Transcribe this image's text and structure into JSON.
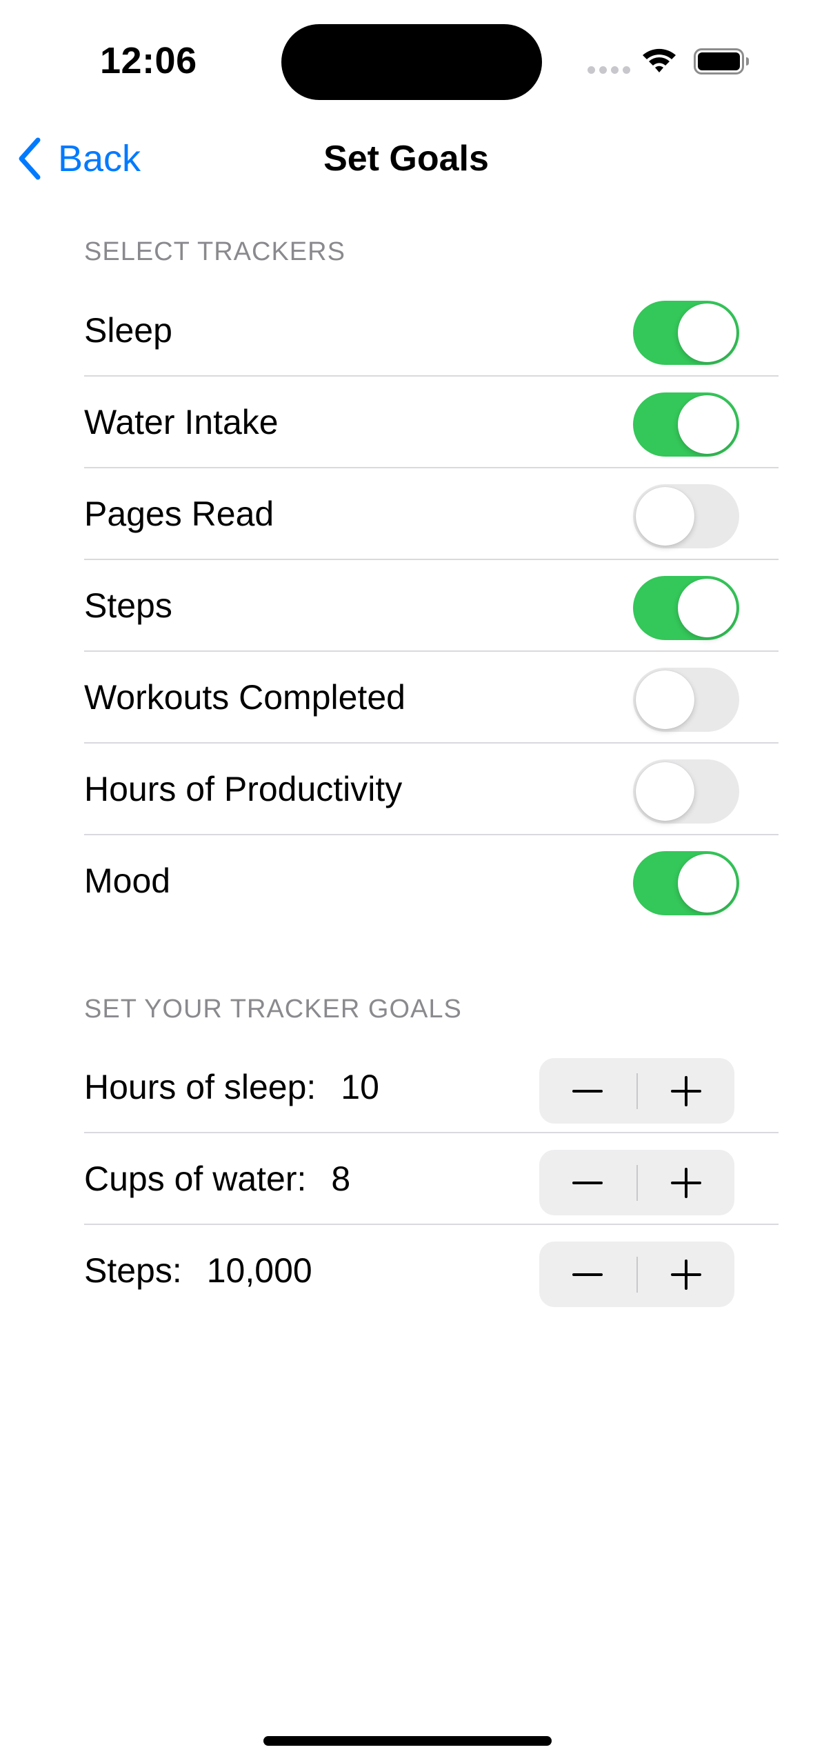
{
  "status_bar": {
    "time": "12:06",
    "icons": [
      "cell-signal-icon",
      "wifi-icon",
      "battery-icon"
    ]
  },
  "nav": {
    "back_label": "Back",
    "back_icon": "chevron-left-icon",
    "title": "Set Goals"
  },
  "trackers": {
    "header": "SELECT TRACKERS",
    "items": [
      {
        "label": "Sleep",
        "on": true
      },
      {
        "label": "Water Intake",
        "on": true
      },
      {
        "label": "Pages Read",
        "on": false
      },
      {
        "label": "Steps",
        "on": true
      },
      {
        "label": "Workouts Completed",
        "on": false
      },
      {
        "label": "Hours of Productivity",
        "on": false
      },
      {
        "label": "Mood",
        "on": true
      }
    ]
  },
  "goals": {
    "header": "SET YOUR TRACKER GOALS",
    "items": [
      {
        "label": "Hours of sleep:",
        "value": "10"
      },
      {
        "label": "Cups of water:",
        "value": "8"
      },
      {
        "label": "Steps:",
        "value": "10,000"
      }
    ],
    "decrement_icon": "minus-icon",
    "increment_icon": "plus-icon"
  },
  "colors": {
    "accent": "#007aff",
    "toggle_on": "#34c759",
    "toggle_off": "#e9e9ea",
    "section_header": "#8a8a8e"
  }
}
